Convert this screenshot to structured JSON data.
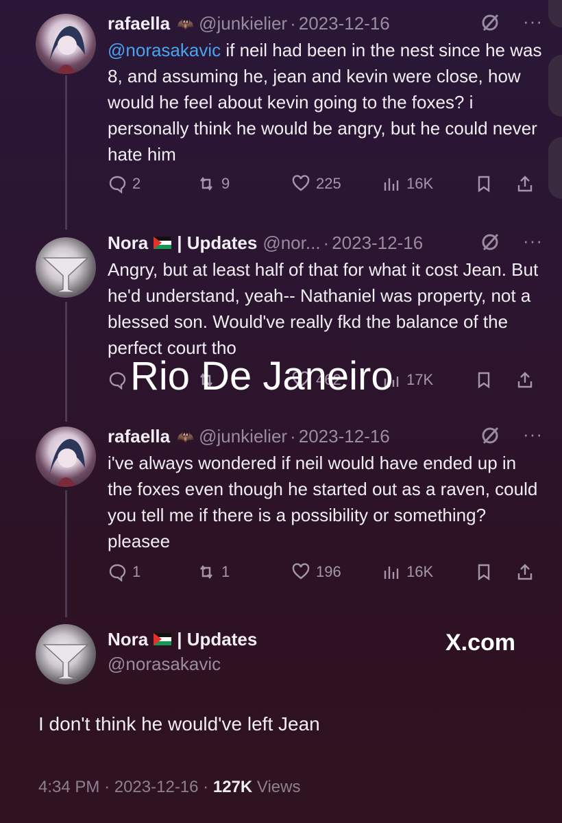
{
  "thread": [
    {
      "name": "rafaella",
      "handle": "@junkielier",
      "date": "2023-12-16",
      "mention": "@norasakavic",
      "text": " if neil had been in the nest since he was 8, and assuming he, jean and kevin were close, how would he feel about kevin going to the foxes? i personally think he would be angry, but he could never hate him",
      "replies": "2",
      "reposts": "9",
      "likes": "225",
      "views": "16K"
    },
    {
      "name": "Nora",
      "name_suffix": "| Updates",
      "handle": "@nor...",
      "date": "2023-12-16",
      "text": "Angry, but at least half of that for what it cost Jean. But he'd understand, yeah-- Nathaniel was property, not a blessed son. Would've really fkd the balance of the perfect court tho",
      "replies": "",
      "reposts": "",
      "likes": "462",
      "views": "17K"
    },
    {
      "name": "rafaella",
      "handle": "@junkielier",
      "date": "2023-12-16",
      "text": "i've always wondered if neil would have ended up in the foxes even though he started out as a raven, could you tell me if there is a possibility or something? pleasee",
      "replies": "1",
      "reposts": "1",
      "likes": "196",
      "views": "16K"
    }
  ],
  "main": {
    "name": "Nora",
    "name_suffix": "| Updates",
    "handle": "@norasakavic",
    "text": "I don't think he would've left Jean",
    "time": "4:34 PM",
    "date": "2023-12-16",
    "views_count": "127K",
    "views_label": "Views"
  },
  "overlay": {
    "watermark": "Rio De Janeiro",
    "site": "X.com"
  },
  "icons": [
    "reply-icon",
    "repost-icon",
    "like-icon",
    "views-icon",
    "bookmark-icon",
    "share-icon",
    "grok-icon",
    "more-icon"
  ]
}
